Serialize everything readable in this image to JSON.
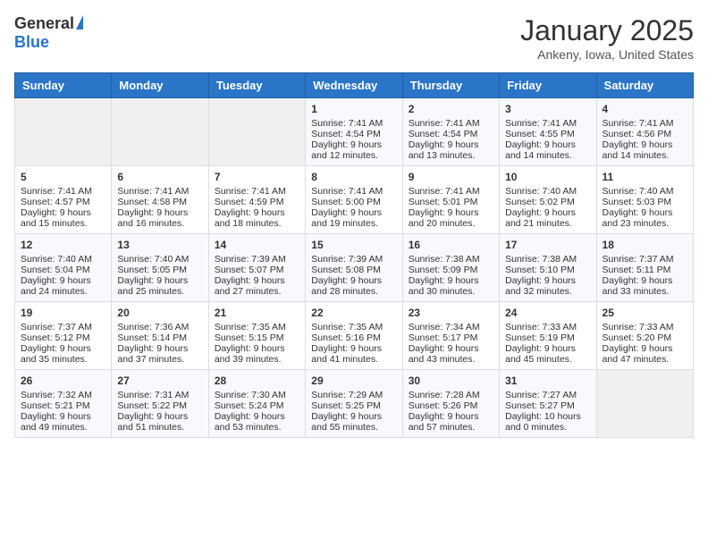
{
  "header": {
    "logo_general": "General",
    "logo_blue": "Blue",
    "month": "January 2025",
    "location": "Ankeny, Iowa, United States"
  },
  "weekdays": [
    "Sunday",
    "Monday",
    "Tuesday",
    "Wednesday",
    "Thursday",
    "Friday",
    "Saturday"
  ],
  "weeks": [
    [
      {
        "day": "",
        "sunrise": "",
        "sunset": "",
        "daylight": ""
      },
      {
        "day": "",
        "sunrise": "",
        "sunset": "",
        "daylight": ""
      },
      {
        "day": "",
        "sunrise": "",
        "sunset": "",
        "daylight": ""
      },
      {
        "day": "1",
        "sunrise": "Sunrise: 7:41 AM",
        "sunset": "Sunset: 4:54 PM",
        "daylight": "Daylight: 9 hours and 12 minutes."
      },
      {
        "day": "2",
        "sunrise": "Sunrise: 7:41 AM",
        "sunset": "Sunset: 4:54 PM",
        "daylight": "Daylight: 9 hours and 13 minutes."
      },
      {
        "day": "3",
        "sunrise": "Sunrise: 7:41 AM",
        "sunset": "Sunset: 4:55 PM",
        "daylight": "Daylight: 9 hours and 14 minutes."
      },
      {
        "day": "4",
        "sunrise": "Sunrise: 7:41 AM",
        "sunset": "Sunset: 4:56 PM",
        "daylight": "Daylight: 9 hours and 14 minutes."
      }
    ],
    [
      {
        "day": "5",
        "sunrise": "Sunrise: 7:41 AM",
        "sunset": "Sunset: 4:57 PM",
        "daylight": "Daylight: 9 hours and 15 minutes."
      },
      {
        "day": "6",
        "sunrise": "Sunrise: 7:41 AM",
        "sunset": "Sunset: 4:58 PM",
        "daylight": "Daylight: 9 hours and 16 minutes."
      },
      {
        "day": "7",
        "sunrise": "Sunrise: 7:41 AM",
        "sunset": "Sunset: 4:59 PM",
        "daylight": "Daylight: 9 hours and 18 minutes."
      },
      {
        "day": "8",
        "sunrise": "Sunrise: 7:41 AM",
        "sunset": "Sunset: 5:00 PM",
        "daylight": "Daylight: 9 hours and 19 minutes."
      },
      {
        "day": "9",
        "sunrise": "Sunrise: 7:41 AM",
        "sunset": "Sunset: 5:01 PM",
        "daylight": "Daylight: 9 hours and 20 minutes."
      },
      {
        "day": "10",
        "sunrise": "Sunrise: 7:40 AM",
        "sunset": "Sunset: 5:02 PM",
        "daylight": "Daylight: 9 hours and 21 minutes."
      },
      {
        "day": "11",
        "sunrise": "Sunrise: 7:40 AM",
        "sunset": "Sunset: 5:03 PM",
        "daylight": "Daylight: 9 hours and 23 minutes."
      }
    ],
    [
      {
        "day": "12",
        "sunrise": "Sunrise: 7:40 AM",
        "sunset": "Sunset: 5:04 PM",
        "daylight": "Daylight: 9 hours and 24 minutes."
      },
      {
        "day": "13",
        "sunrise": "Sunrise: 7:40 AM",
        "sunset": "Sunset: 5:05 PM",
        "daylight": "Daylight: 9 hours and 25 minutes."
      },
      {
        "day": "14",
        "sunrise": "Sunrise: 7:39 AM",
        "sunset": "Sunset: 5:07 PM",
        "daylight": "Daylight: 9 hours and 27 minutes."
      },
      {
        "day": "15",
        "sunrise": "Sunrise: 7:39 AM",
        "sunset": "Sunset: 5:08 PM",
        "daylight": "Daylight: 9 hours and 28 minutes."
      },
      {
        "day": "16",
        "sunrise": "Sunrise: 7:38 AM",
        "sunset": "Sunset: 5:09 PM",
        "daylight": "Daylight: 9 hours and 30 minutes."
      },
      {
        "day": "17",
        "sunrise": "Sunrise: 7:38 AM",
        "sunset": "Sunset: 5:10 PM",
        "daylight": "Daylight: 9 hours and 32 minutes."
      },
      {
        "day": "18",
        "sunrise": "Sunrise: 7:37 AM",
        "sunset": "Sunset: 5:11 PM",
        "daylight": "Daylight: 9 hours and 33 minutes."
      }
    ],
    [
      {
        "day": "19",
        "sunrise": "Sunrise: 7:37 AM",
        "sunset": "Sunset: 5:12 PM",
        "daylight": "Daylight: 9 hours and 35 minutes."
      },
      {
        "day": "20",
        "sunrise": "Sunrise: 7:36 AM",
        "sunset": "Sunset: 5:14 PM",
        "daylight": "Daylight: 9 hours and 37 minutes."
      },
      {
        "day": "21",
        "sunrise": "Sunrise: 7:35 AM",
        "sunset": "Sunset: 5:15 PM",
        "daylight": "Daylight: 9 hours and 39 minutes."
      },
      {
        "day": "22",
        "sunrise": "Sunrise: 7:35 AM",
        "sunset": "Sunset: 5:16 PM",
        "daylight": "Daylight: 9 hours and 41 minutes."
      },
      {
        "day": "23",
        "sunrise": "Sunrise: 7:34 AM",
        "sunset": "Sunset: 5:17 PM",
        "daylight": "Daylight: 9 hours and 43 minutes."
      },
      {
        "day": "24",
        "sunrise": "Sunrise: 7:33 AM",
        "sunset": "Sunset: 5:19 PM",
        "daylight": "Daylight: 9 hours and 45 minutes."
      },
      {
        "day": "25",
        "sunrise": "Sunrise: 7:33 AM",
        "sunset": "Sunset: 5:20 PM",
        "daylight": "Daylight: 9 hours and 47 minutes."
      }
    ],
    [
      {
        "day": "26",
        "sunrise": "Sunrise: 7:32 AM",
        "sunset": "Sunset: 5:21 PM",
        "daylight": "Daylight: 9 hours and 49 minutes."
      },
      {
        "day": "27",
        "sunrise": "Sunrise: 7:31 AM",
        "sunset": "Sunset: 5:22 PM",
        "daylight": "Daylight: 9 hours and 51 minutes."
      },
      {
        "day": "28",
        "sunrise": "Sunrise: 7:30 AM",
        "sunset": "Sunset: 5:24 PM",
        "daylight": "Daylight: 9 hours and 53 minutes."
      },
      {
        "day": "29",
        "sunrise": "Sunrise: 7:29 AM",
        "sunset": "Sunset: 5:25 PM",
        "daylight": "Daylight: 9 hours and 55 minutes."
      },
      {
        "day": "30",
        "sunrise": "Sunrise: 7:28 AM",
        "sunset": "Sunset: 5:26 PM",
        "daylight": "Daylight: 9 hours and 57 minutes."
      },
      {
        "day": "31",
        "sunrise": "Sunrise: 7:27 AM",
        "sunset": "Sunset: 5:27 PM",
        "daylight": "Daylight: 10 hours and 0 minutes."
      },
      {
        "day": "",
        "sunrise": "",
        "sunset": "",
        "daylight": ""
      }
    ]
  ]
}
